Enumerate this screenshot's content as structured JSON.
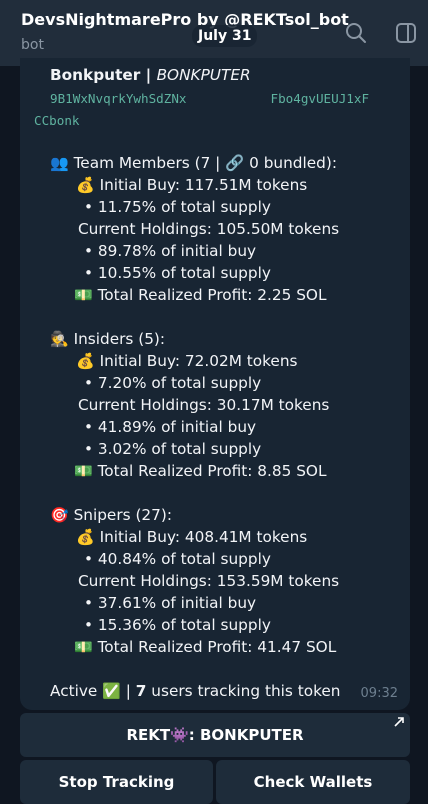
{
  "header": {
    "title": "DevsNightmarePro by @REKTsol_bot",
    "subtitle": "bot",
    "icons": [
      "search-icon",
      "side-panel-icon"
    ]
  },
  "date_badge": "July 31",
  "message": {
    "sender_name": "Bonkputer",
    "sender_sep": " | ",
    "sender_ticker": "BONKPUTER",
    "address_line1": "9B1WxNvqrkYwhSdZNx",
    "address_line1_end": "Fbo4gvUEUJ1xF",
    "address_line2": "CCbonk",
    "team": {
      "header": "Team Members (7 | 🔗 0 bundled):",
      "initial_buy": "Initial Buy: 117.51M tokens",
      "initial_pct": "• 11.75% of total supply",
      "holdings": "Current Holdings: 105.50M tokens",
      "hold_initial": "• 89.78% of initial buy",
      "hold_supply": "• 10.55% of total supply",
      "profit": "Total Realized Profit: 2.25 SOL"
    },
    "insiders": {
      "header": "Insiders (5):",
      "initial_buy": "Initial Buy: 72.02M tokens",
      "initial_pct": "• 7.20% of total supply",
      "holdings": "Current Holdings: 30.17M tokens",
      "hold_initial": "• 41.89% of initial buy",
      "hold_supply": "• 3.02% of total supply",
      "profit": "Total Realized Profit: 8.85 SOL"
    },
    "snipers": {
      "header": "Snipers (27):",
      "initial_buy": "Initial Buy: 408.41M tokens",
      "initial_pct": "• 40.84% of total supply",
      "holdings": "Current Holdings: 153.59M tokens",
      "hold_initial": "• 37.61% of initial buy",
      "hold_supply": "• 15.36% of total supply",
      "profit": "Total Realized Profit: 41.47 SOL"
    },
    "status_prefix": "Active",
    "status_sep": " | ",
    "tracking_count": "7",
    "tracking_text": " users tracking this token",
    "time": "09:32"
  },
  "buttons": {
    "main": "REKT👾: BONKPUTER",
    "stop": "Stop Tracking",
    "check": "Check Wallets"
  },
  "colors": {
    "header_bg": "#212d3b",
    "bubble_bg": "#182533",
    "address": "#5fb3a0",
    "button_bg": "#1e2c3a"
  }
}
